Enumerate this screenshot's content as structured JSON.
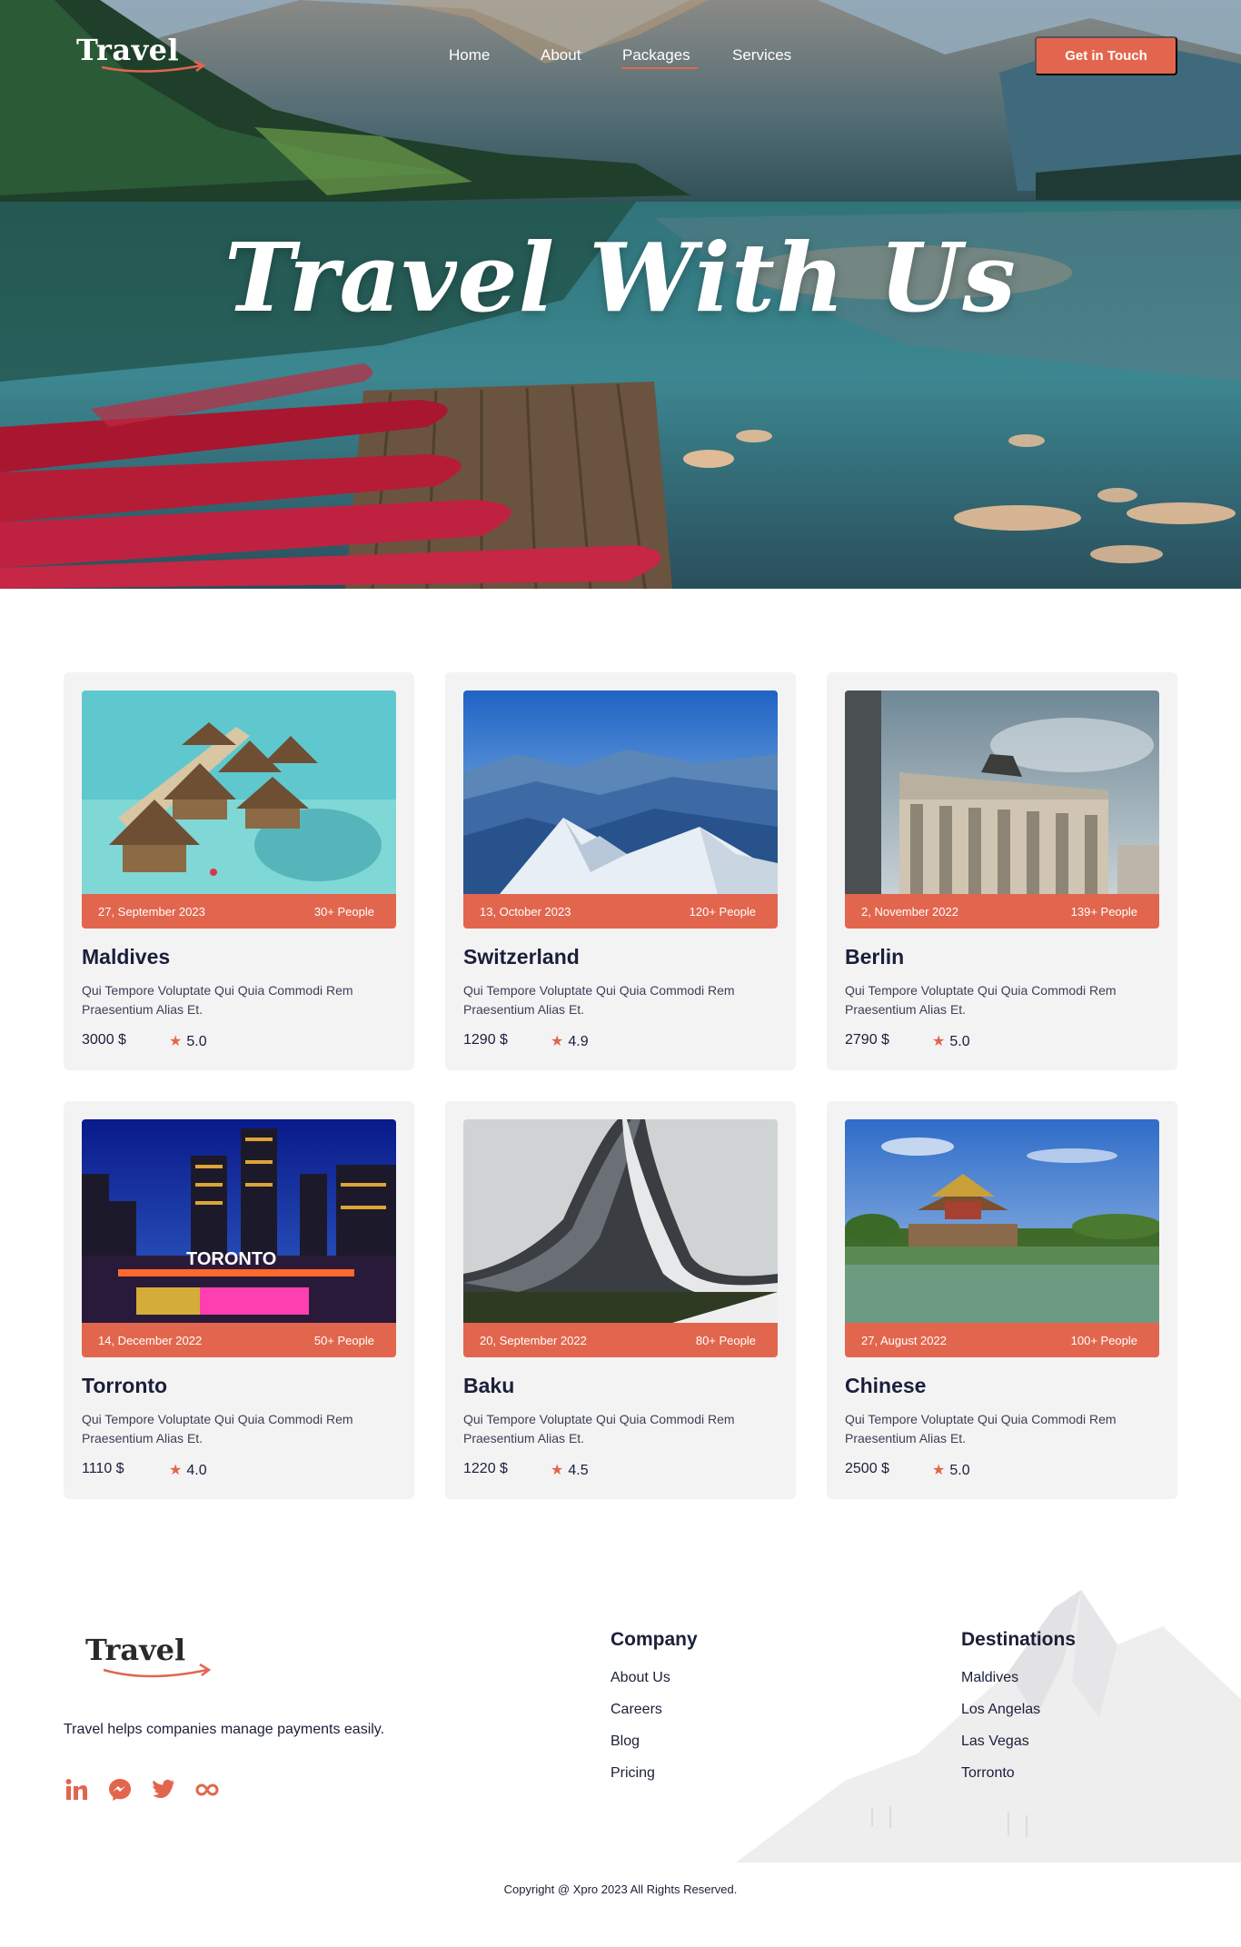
{
  "header": {
    "logo": "Travel",
    "nav": [
      "Home",
      "About",
      "Packages",
      "Services"
    ],
    "active_nav": "Packages",
    "cta": "Get in Touch"
  },
  "hero": {
    "title": "Travel With Us"
  },
  "packages": [
    {
      "name": "Maldives",
      "date": "27, September 2023",
      "people": "30+ People",
      "description": "Qui Tempore Voluptate Qui Quia Commodi Rem Praesentium Alias Et.",
      "price": "3000 $",
      "rating": "5.0"
    },
    {
      "name": "Switzerland",
      "date": "13, October 2023",
      "people": "120+ People",
      "description": "Qui Tempore Voluptate Qui Quia Commodi Rem Praesentium Alias Et.",
      "price": "1290 $",
      "rating": "4.9"
    },
    {
      "name": "Berlin",
      "date": "2, November 2022",
      "people": "139+ People",
      "description": "Qui Tempore Voluptate Qui Quia Commodi Rem Praesentium Alias Et.",
      "price": "2790 $",
      "rating": "5.0"
    },
    {
      "name": "Torronto",
      "date": "14, December 2022",
      "people": "50+ People",
      "description": "Qui Tempore Voluptate Qui Quia Commodi Rem Praesentium Alias Et.",
      "price": "1110 $",
      "rating": "4.0",
      "sign": "TORONTO"
    },
    {
      "name": "Baku",
      "date": "20, September 2022",
      "people": "80+ People",
      "description": "Qui Tempore Voluptate Qui Quia Commodi Rem Praesentium Alias Et.",
      "price": "1220 $",
      "rating": "4.5"
    },
    {
      "name": "Chinese",
      "date": "27, August 2022",
      "people": "100+ People",
      "description": "Qui Tempore Voluptate Qui Quia Commodi Rem Praesentium Alias Et.",
      "price": "2500 $",
      "rating": "5.0"
    }
  ],
  "footer": {
    "logo": "Travel",
    "tagline": "Travel helps companies manage payments easily.",
    "social_icons": [
      "linkedin-icon",
      "messenger-icon",
      "twitter-icon",
      "infinity-icon"
    ],
    "company": {
      "heading": "Company",
      "links": [
        "About Us",
        "Careers",
        "Blog",
        "Pricing"
      ]
    },
    "destinations": {
      "heading": "Destinations",
      "links": [
        "Maldives",
        "Los Angelas",
        "Las Vegas",
        "Torronto"
      ]
    },
    "copyright": "Copyright @ Xpro 2023 All Rights Reserved."
  },
  "colors": {
    "accent": "#e2664e",
    "navy": "#1a1f3a",
    "card_bg": "#f4f3f4"
  }
}
